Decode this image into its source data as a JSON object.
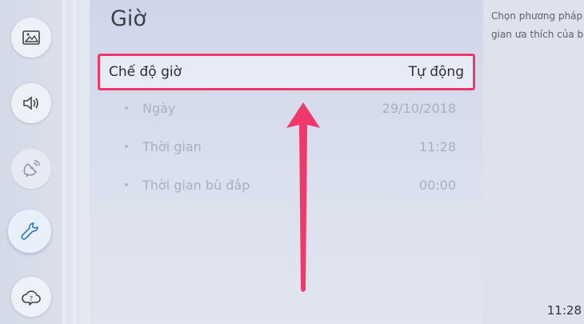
{
  "rail": {
    "items": [
      {
        "icon": "picture-icon"
      },
      {
        "icon": "sound-icon"
      },
      {
        "icon": "broadcast-icon"
      },
      {
        "icon": "wrench-icon"
      },
      {
        "icon": "help-cloud-icon"
      }
    ]
  },
  "panel": {
    "title": "Giờ",
    "selected": {
      "label": "Chế độ giờ",
      "value": "Tự động"
    },
    "rows": [
      {
        "label": "Ngày",
        "value": "29/10/2018"
      },
      {
        "label": "Thời gian",
        "value": "11:28"
      },
      {
        "label": "Thời gian bù đắp",
        "value": "00:00"
      }
    ]
  },
  "info": {
    "line1": "Chọn phương pháp",
    "line2": "gian ưa thích của bạ"
  },
  "clock": "11:28",
  "colors": {
    "highlight_border": "#f0386b",
    "arrow": "#f0386b"
  }
}
